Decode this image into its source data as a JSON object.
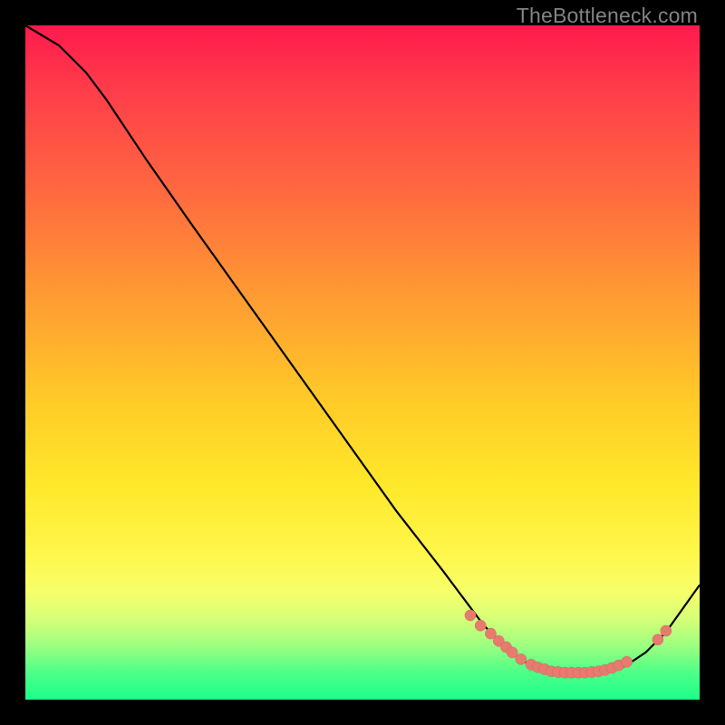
{
  "watermark": "TheBottleneck.com",
  "chart_data": {
    "type": "line",
    "title": "",
    "xlabel": "",
    "ylabel": "",
    "xlim": [
      0,
      100
    ],
    "ylim": [
      0,
      100
    ],
    "series": [
      {
        "name": "curve",
        "x": [
          0,
          5,
          9,
          12,
          18,
          25,
          35,
          45,
          55,
          62,
          68,
          72,
          75,
          78,
          80,
          83,
          86,
          89,
          92,
          95,
          100
        ],
        "y": [
          100,
          97,
          93,
          89,
          80,
          70,
          56,
          42,
          28,
          19,
          11,
          7,
          5,
          4,
          4,
          4,
          4,
          5,
          7,
          10,
          17
        ]
      }
    ],
    "highlight_points": {
      "name": "highlighted-range",
      "x": [
        66,
        67.5,
        69,
        70.2,
        71.3,
        72.2,
        73.5,
        75,
        76,
        77,
        78,
        79,
        80,
        81,
        82,
        83,
        84,
        85,
        86,
        87,
        88,
        89.2,
        93.8,
        95
      ],
      "y": [
        12.5,
        11,
        9.8,
        8.7,
        7.8,
        7.0,
        6.0,
        5.2,
        4.8,
        4.5,
        4.2,
        4.1,
        4.0,
        4.0,
        4.0,
        4.0,
        4.1,
        4.2,
        4.4,
        4.7,
        5.1,
        5.6,
        8.9,
        10.2
      ]
    },
    "colors": {
      "curve": "#000000",
      "dots": "#e87a6f",
      "gradient_top": "#ff1a4d",
      "gradient_bottom": "#1bff8a"
    }
  }
}
